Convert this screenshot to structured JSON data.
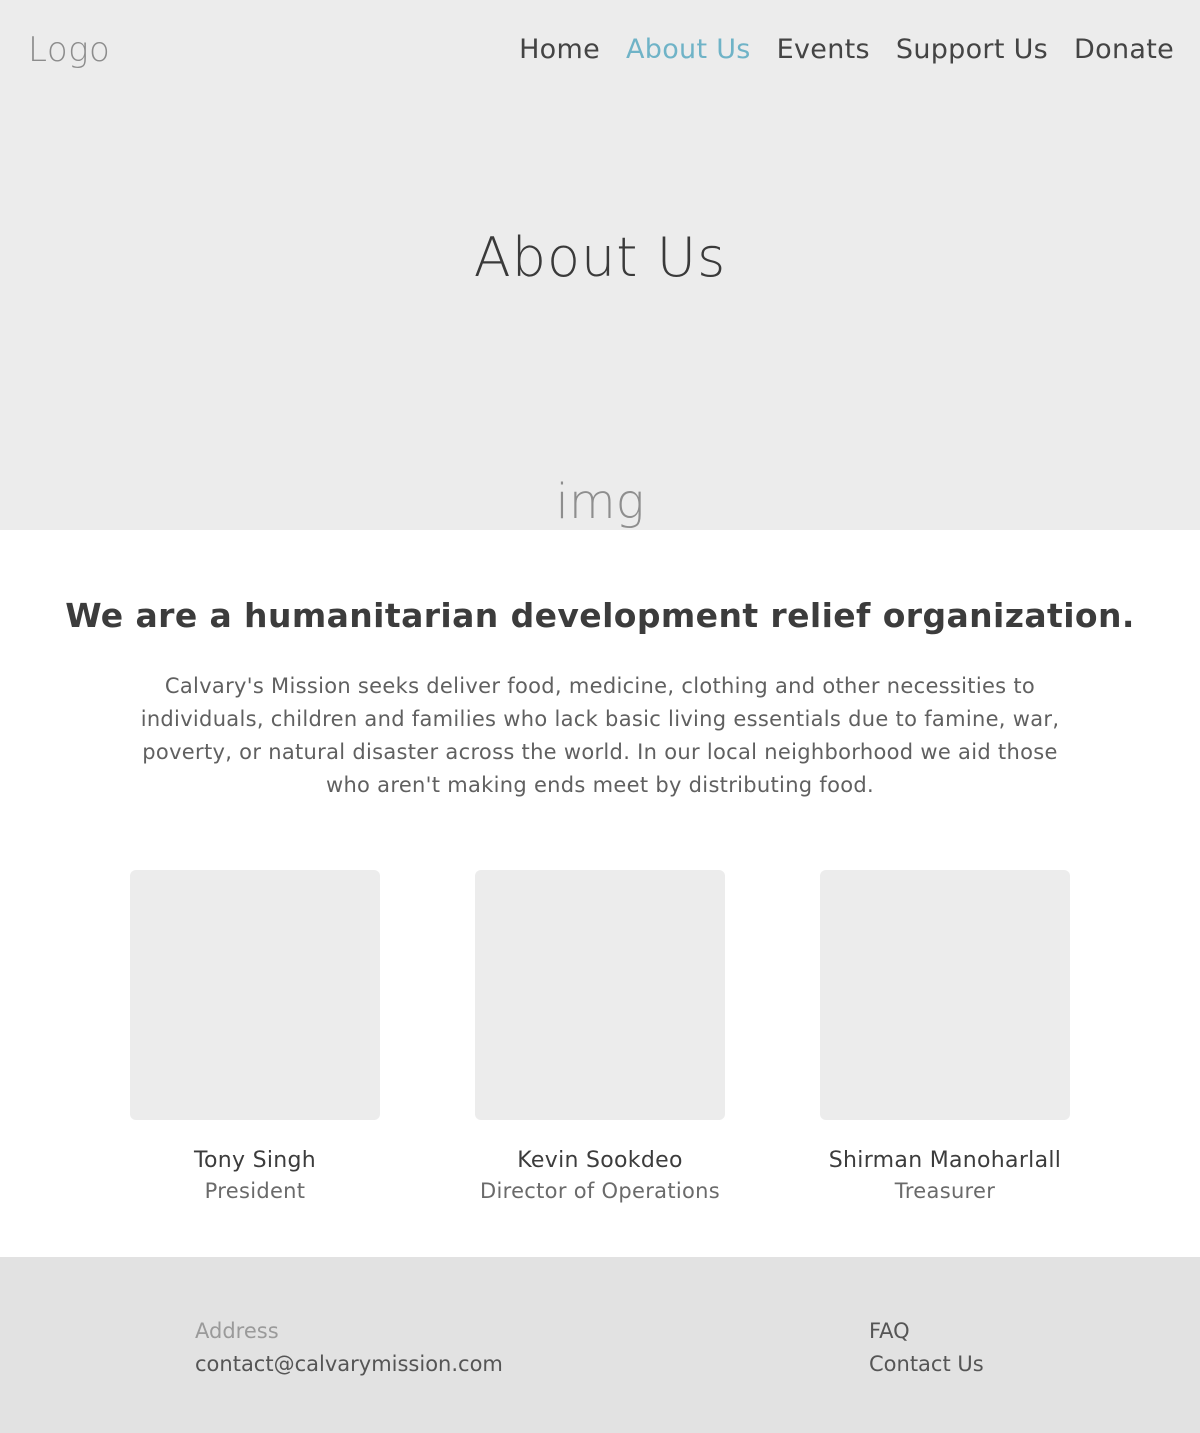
{
  "header": {
    "logo": "Logo",
    "nav": [
      {
        "label": "Home"
      },
      {
        "label": "About Us"
      },
      {
        "label": "Events"
      },
      {
        "label": "Support Us"
      },
      {
        "label": "Donate"
      }
    ],
    "active_nav": "About Us",
    "active_color": "#6fb3c7"
  },
  "hero": {
    "title": "About Us",
    "image_label": "img"
  },
  "intro": {
    "headline": "We are a humanitarian development relief organization.",
    "body": "Calvary's Mission seeks deliver food, medicine, clothing and other necessities to individuals, children and families who lack basic living essentials due to famine, war, poverty, or natural disaster across the world. In our local neighborhood we aid those who aren't making ends meet by distributing food."
  },
  "team": [
    {
      "name": "Tony Singh",
      "role": "President"
    },
    {
      "name": "Kevin Sookdeo",
      "role": "Director of Operations"
    },
    {
      "name": "Shirman Manoharlall",
      "role": "Treasurer"
    }
  ],
  "footer": {
    "address": "Address",
    "email": "contact@calvarymission.com",
    "faq": "FAQ",
    "contact": "Contact Us"
  }
}
